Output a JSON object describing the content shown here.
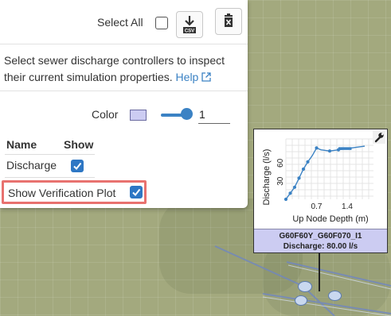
{
  "toolbar": {
    "select_all_label": "Select All",
    "select_all_checked": false,
    "download_icon": "download-csv-icon",
    "download_caption": "CSV",
    "delete_icon": "trash-icon"
  },
  "description": {
    "text": "Select sewer discharge controllers to inspect their current simulation properties.",
    "help_label": "Help",
    "help_icon": "external-link-icon"
  },
  "style": {
    "color_label": "Color",
    "swatch_color": "#ccccf2",
    "slider_value": "1"
  },
  "table": {
    "headers": [
      "Name",
      "Show"
    ],
    "rows": [
      {
        "name": "Discharge",
        "show": true
      }
    ]
  },
  "verification": {
    "label": "Show Verification Plot",
    "checked": true
  },
  "popup": {
    "wrench_icon": "wrench-icon",
    "controller_id": "G60F60Y_G60F070_I1",
    "discharge_text": "Discharge: 80.00 l/s",
    "chart_data": {
      "type": "line",
      "xlabel": "Up Node Depth (m)",
      "ylabel": "Discharge (l/s)",
      "x_ticks": [
        "0.7",
        "1.4"
      ],
      "y_ticks": [
        "30",
        "60"
      ],
      "xlim": [
        0,
        2.0
      ],
      "ylim": [
        0,
        100
      ],
      "series": [
        {
          "values": [
            [
              0.0,
              0
            ],
            [
              0.1,
              10
            ],
            [
              0.2,
              20
            ],
            [
              0.3,
              35
            ],
            [
              0.4,
              50
            ],
            [
              0.5,
              62
            ],
            [
              0.6,
              72
            ],
            [
              0.7,
              85
            ],
            [
              0.8,
              82
            ],
            [
              1.0,
              80
            ],
            [
              1.2,
              82
            ],
            [
              1.4,
              84
            ],
            [
              1.6,
              86
            ],
            [
              1.8,
              88
            ]
          ]
        }
      ],
      "markers": [
        [
          0.0,
          0
        ],
        [
          0.1,
          10
        ],
        [
          0.2,
          20
        ],
        [
          0.3,
          35
        ],
        [
          0.4,
          50
        ],
        [
          0.5,
          62
        ],
        [
          0.7,
          85
        ],
        [
          1.0,
          80
        ],
        [
          1.2,
          82
        ]
      ],
      "color": "#3b82c4"
    }
  }
}
